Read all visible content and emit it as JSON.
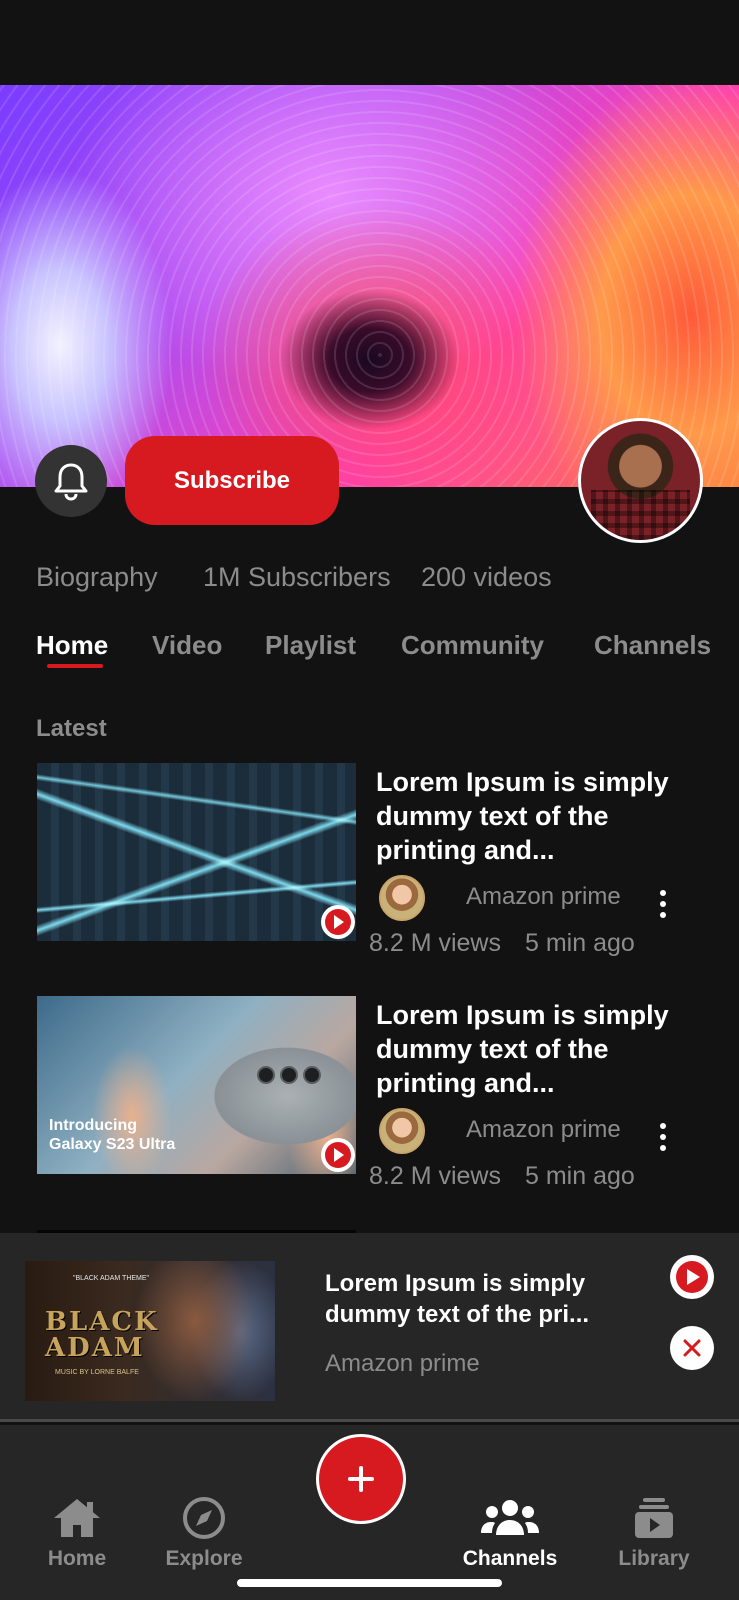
{
  "channel": {
    "subscribe_label": "Subscribe",
    "stats": {
      "biography": "Biography",
      "subscribers": "1M Subscribers",
      "videos": "200 videos"
    }
  },
  "tabs": [
    {
      "label": "Home",
      "active": true
    },
    {
      "label": "Video",
      "active": false
    },
    {
      "label": "Playlist",
      "active": false
    },
    {
      "label": "Community",
      "active": false
    },
    {
      "label": "Channels",
      "active": false
    }
  ],
  "section_title": "Latest",
  "videos": [
    {
      "title": "Lorem Ipsum is simply dummy text of the printing and...",
      "channel": "Amazon prime",
      "views": "8.2 M views",
      "age": "5 min ago"
    },
    {
      "title": "Lorem Ipsum is simply dummy text of the printing and...",
      "channel": "Amazon prime",
      "views": "8.2 M views",
      "age": "5 min ago",
      "thumb_text_line1": "Introducing",
      "thumb_text_line2": "Galaxy S23 Ultra"
    }
  ],
  "mini_player": {
    "title": "Lorem Ipsum is simply dummy text of the pri...",
    "channel": "Amazon prime",
    "thumb_title_line1": "BLACK",
    "thumb_title_line2": "ADAM",
    "thumb_small": "\"BLACK ADAM THEME\"",
    "thumb_credit": "MUSIC BY LORNE BALFE"
  },
  "bottom_nav": [
    {
      "label": "Home",
      "icon": "home-icon"
    },
    {
      "label": "Explore",
      "icon": "compass-icon"
    },
    {
      "label": "Channels",
      "icon": "users-icon",
      "active": true
    },
    {
      "label": "Library",
      "icon": "library-icon"
    }
  ],
  "colors": {
    "accent": "#d71920",
    "background": "#121212",
    "surface": "#262626",
    "muted_text": "#8c8c8c"
  }
}
